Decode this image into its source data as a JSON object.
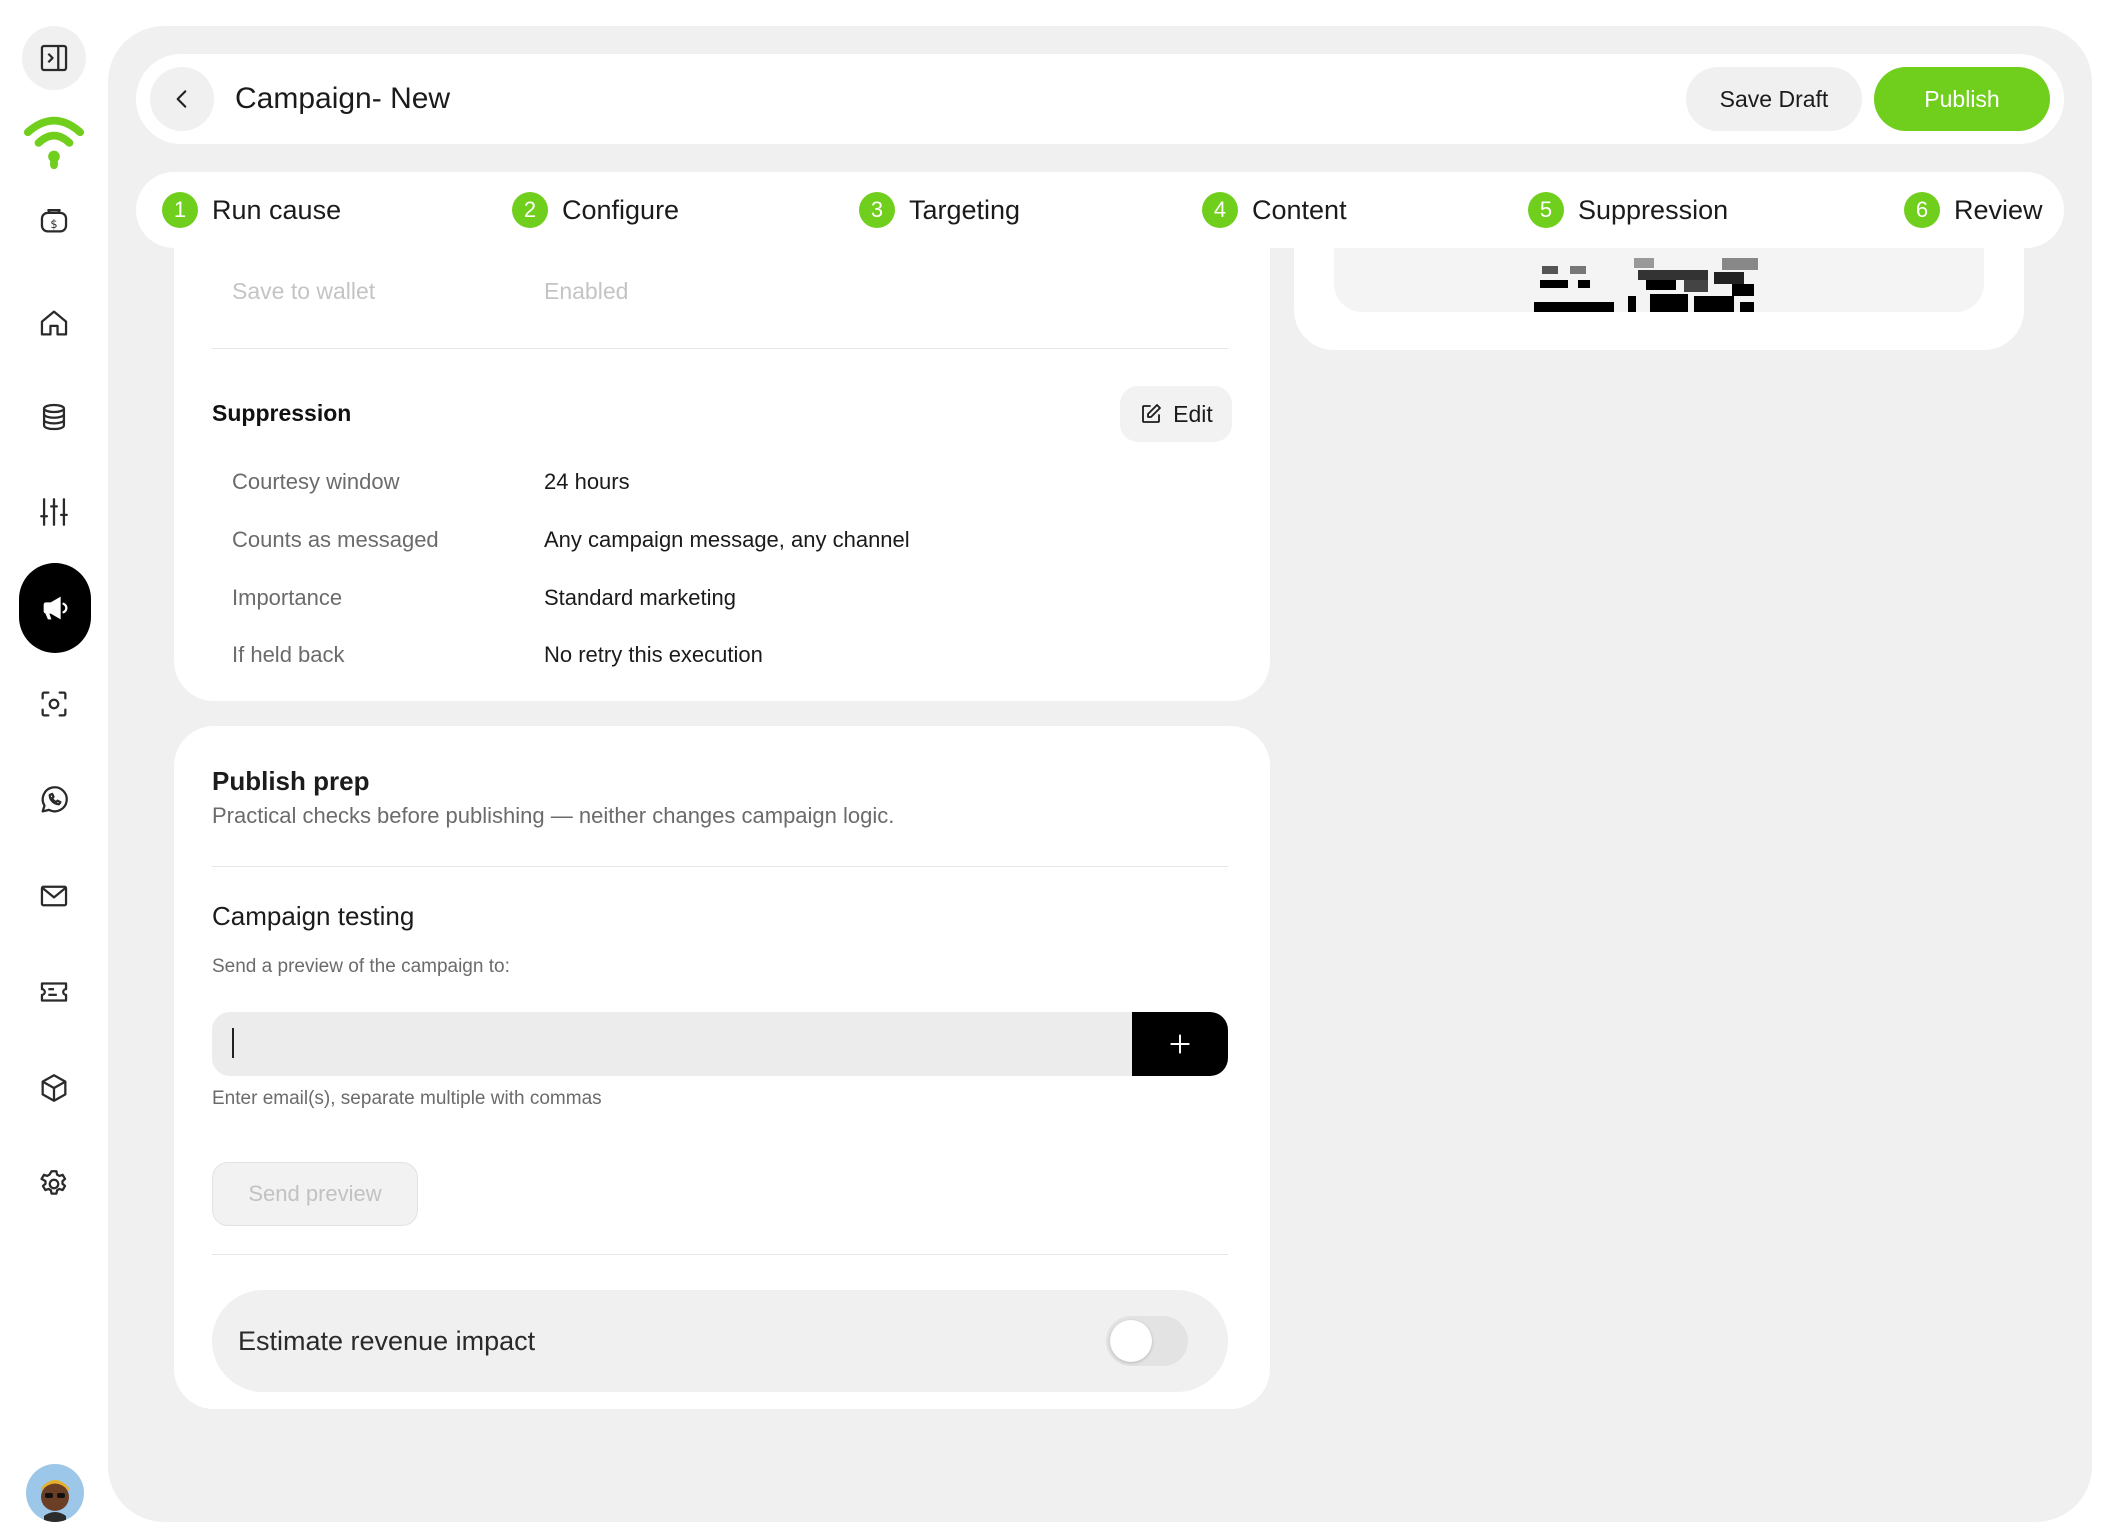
{
  "app": {
    "brand_color": "#6fcf1c"
  },
  "header": {
    "title": "Campaign- New",
    "save_draft_label": "Save Draft",
    "publish_label": "Publish"
  },
  "stepper": {
    "steps": [
      {
        "num": "1",
        "label": "Run cause"
      },
      {
        "num": "2",
        "label": "Configure"
      },
      {
        "num": "3",
        "label": "Targeting"
      },
      {
        "num": "4",
        "label": "Content"
      },
      {
        "num": "5",
        "label": "Suppression"
      },
      {
        "num": "6",
        "label": "Review"
      }
    ]
  },
  "review": {
    "wallet_row": {
      "label": "Save to wallet",
      "value": "Enabled"
    },
    "suppression": {
      "title": "Suppression",
      "edit_label": "Edit",
      "rows": [
        {
          "label": "Courtesy window",
          "value": "24 hours"
        },
        {
          "label": "Counts as messaged",
          "value": "Any campaign message, any channel"
        },
        {
          "label": "Importance",
          "value": "Standard marketing"
        },
        {
          "label": "If held back",
          "value": "No retry this execution"
        }
      ]
    }
  },
  "publish_prep": {
    "title": "Publish prep",
    "subtitle": "Practical checks before publishing — neither changes campaign logic.",
    "testing": {
      "title": "Campaign testing",
      "hint": "Send a preview of the campaign to:",
      "input_value": "",
      "help_text": "Enter email(s), separate multiple with commas",
      "send_label": "Send preview"
    },
    "revenue": {
      "label": "Estimate revenue impact",
      "enabled": false
    }
  },
  "sidebar": {
    "icons": [
      "panel-toggle-icon",
      "brand-logo",
      "wallet-icon",
      "home-icon",
      "database-icon",
      "sliders-icon",
      "megaphone-icon",
      "scan-icon",
      "whatsapp-icon",
      "mail-icon",
      "ticket-icon",
      "box-icon",
      "settings-icon"
    ],
    "active": "megaphone-icon"
  }
}
